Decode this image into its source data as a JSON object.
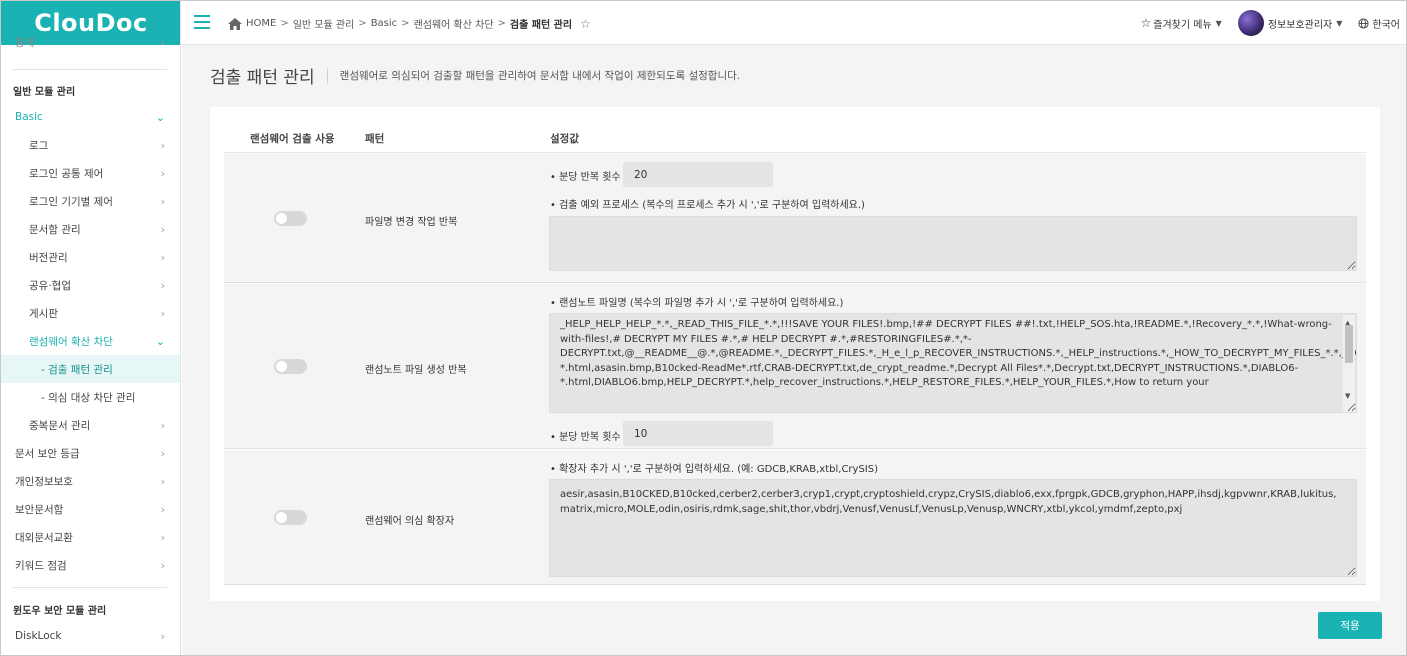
{
  "app": {
    "logo": "ClouDoc"
  },
  "sidebar": {
    "partial_top": "통계",
    "section_general": "일반 모듈 관리",
    "basic": "Basic",
    "items_basic": [
      "로그",
      "로그인 공통 제어",
      "로그인 기기별 제어",
      "문서함 관리",
      "버전관리",
      "공유·협업",
      "게시판"
    ],
    "ransomware": "랜섬웨어 확산 차단",
    "ransomware_children": [
      "- 검출 패턴 관리",
      "- 의심 대상 차단 관리"
    ],
    "dup_docs": "중복문서 관리",
    "items_top": [
      "문서 보안 등급",
      "개인정보보호",
      "보안문서함",
      "대외문서교환",
      "키워드 점검"
    ],
    "section_windows": "윈도우 보안 모듈 관리",
    "disklock": "DiskLock"
  },
  "topbar": {
    "breadcrumb": [
      "HOME",
      "일반 모듈 관리",
      "Basic",
      "랜섬웨어 확산 차단",
      "검출 패턴 관리"
    ],
    "breadcrumb_sep": ">",
    "favorites": "즐겨찾기 메뉴",
    "user": "정보보호관리자",
    "language": "한국어"
  },
  "page": {
    "title": "검출 패턴 관리",
    "description": "랜섬웨어로 의심되어 검출할 패턴을 관리하여 문서함 내에서 작업이 제한되도록 설정합니다."
  },
  "table": {
    "headers": [
      "랜섬웨어 검출 사용",
      "패턴",
      "설정값"
    ],
    "rows": [
      {
        "enabled": false,
        "pattern": "파일명 변경 작업 반복",
        "label_count": "• 분당 반복 횟수 :",
        "count_value": "20",
        "label_exclude": "• 검출 예외 프로세스 (복수의 프로세스 추가 시 ','로 구분하여 입력하세요.)",
        "exclude_value": ""
      },
      {
        "enabled": false,
        "pattern": "랜섬노트 파일 생성 반복",
        "label_filenames": "• 랜섬노트 파일명 (복수의 파일명 추가 시 ','로 구분하여 입력하세요.)",
        "filenames_value": "_HELP_HELP_HELP_*.*,_READ_THIS_FILE_*.*,!!!SAVE YOUR FILES!.bmp,!## DECRYPT FILES ##!.txt,!HELP_SOS.hta,!README.*,!Recovery_*.*,!What-wrong-with-files!,# DECRYPT MY FILES #.*,# HELP DECRYPT #.*,#RESTORINGFILES#.*,*-DECRYPT.txt,@__README__@.*,@README.*,_DECRYPT_FILES.*,_H_e_l_p_RECOVER_INSTRUCTIONS.*,_HELP_instructions.*,_HOW_TO_DECRYPT_MY_FILES_*.*,_HOWDO_text.*,_R_E_A_D___T_H_I_S___*.*,_READ_THI$_FILE_*.*,_README_.*,_WHAT_is.*,asasin-*.html,asasin.bmp,B10cked-ReadMe*.rtf,CRAB-DECRYPT.txt,de_crypt_readme.*,Decrypt All Files*.*,Decrypt.txt,DECRYPT_INSTRUCTIONS.*,DIABLO6-*.html,DIABLO6.bmp,HELP_DECRYPT.*,help_recover_instructions.*,HELP_RESTORE_FILES.*,HELP_YOUR_FILES.*,How to return your",
        "label_count": "• 분당 반복 횟수 :",
        "count_value": "10"
      },
      {
        "enabled": false,
        "pattern": "랜섬웨어 의심 확장자",
        "label_ext": "• 확장자 추가 시 ','로 구분하여 입력하세요. (예: GDCB,KRAB,xtbl,CrySIS)",
        "ext_value": "aesir,asasin,B10CKED,B10cked,cerber2,cerber3,cryp1,crypt,cryptoshield,crypz,CrySIS,diablo6,exx,fprgpk,GDCB,gryphon,HAPP,ihsdj,kgpvwnr,KRAB,lukitus,matrix,micro,MOLE,odin,osiris,rdmk,sage,shit,thor,vbdrj,Venusf,VenusLf,VenusLp,Venusp,WNCRY,xtbl,ykcol,ymdmf,zepto,pxj"
      }
    ]
  },
  "actions": {
    "apply": "적용"
  },
  "colors": {
    "brand": "#1ab2b2",
    "toggle_off": "#d8d8d8",
    "input_bg": "#e4e4e4"
  },
  "icons": [
    "menu-icon",
    "home-icon",
    "star-icon",
    "chevron-right-icon",
    "chevron-down-icon",
    "globe-icon",
    "avatar"
  ]
}
